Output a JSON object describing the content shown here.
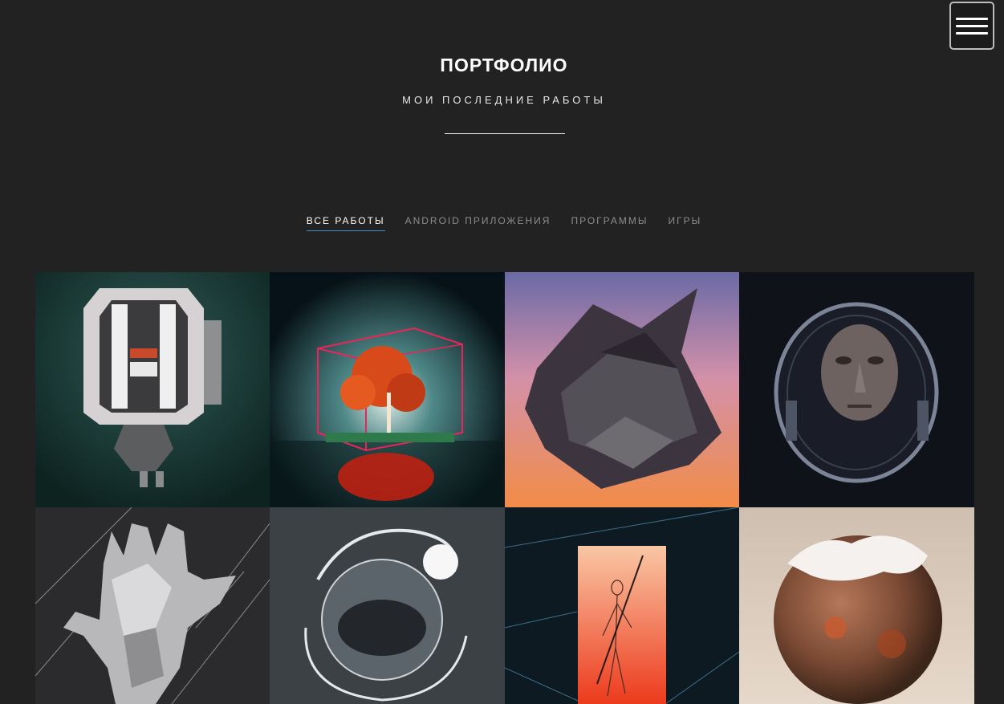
{
  "header": {
    "title": "ПОРТФОЛИО",
    "subtitle": "МОИ ПОСЛЕДНИЕ РАБОТЫ"
  },
  "menu": {
    "icon": "hamburger-menu-icon"
  },
  "filters": [
    {
      "label": "ВСЕ РАБОТЫ",
      "active": true
    },
    {
      "label": "ANDROID ПРИЛОЖЕНИЯ",
      "active": false
    },
    {
      "label": "ПРОГРАММЫ",
      "active": false
    },
    {
      "label": "ИГРЫ",
      "active": false
    }
  ],
  "colors": {
    "background": "#232223",
    "accent_underline": "#3d8fd1",
    "inactive_filter": "#8d8d8d"
  },
  "portfolio": {
    "items": [
      {
        "subject": "robot-head-render"
      },
      {
        "subject": "tree-in-glass-cube"
      },
      {
        "subject": "floating-crystal-rock"
      },
      {
        "subject": "astronaut-old-face"
      },
      {
        "subject": "low-poly-hand"
      },
      {
        "subject": "planet-with-ring"
      },
      {
        "subject": "wireframe-figure-red-portal"
      },
      {
        "subject": "cotton-covered-sphere"
      }
    ]
  }
}
